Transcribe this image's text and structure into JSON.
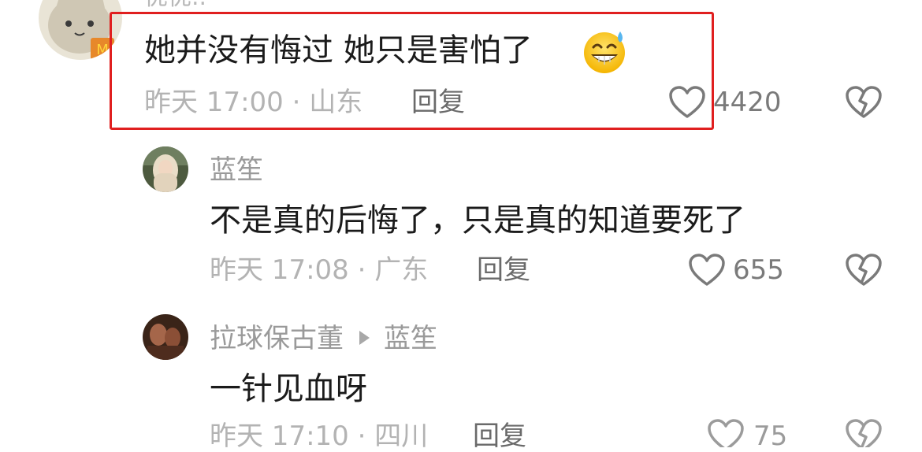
{
  "comments": [
    {
      "username": "优优..",
      "text": "她并没有悔过 她只是害怕了",
      "emoji_icon": "grinning-sweat-face-icon",
      "time": "昨天 17:00",
      "location": "山东",
      "reply_label": "回复",
      "likes": "4420",
      "highlight_color": "#e01f1f"
    },
    {
      "username": "蓝笙",
      "text": "不是真的后悔了，只是真的知道要死了",
      "time": "昨天 17:08",
      "location": "广东",
      "reply_label": "回复",
      "likes": "655"
    },
    {
      "username": "拉球保古董",
      "reply_to": "蓝笙",
      "text": "一针见血呀",
      "time": "昨天 17:10",
      "location": "四川",
      "reply_label": "回复",
      "likes": "75"
    }
  ]
}
